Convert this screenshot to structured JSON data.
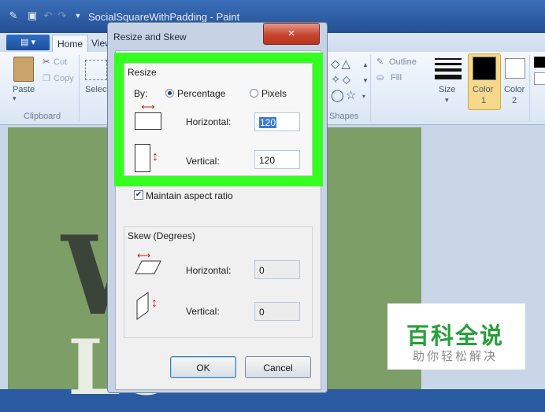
{
  "app": {
    "title": "SocialSquareWithPadding - Paint"
  },
  "ribbon": {
    "tabs": [
      "Home",
      "View"
    ],
    "paste_label": "Paste",
    "cut_label": "Cut",
    "copy_label": "Copy",
    "select_label": "Select",
    "clipboard_group": "Clipboard",
    "shapes_group": "Shapes",
    "outline_label": "Outline",
    "fill_label": "Fill",
    "size_label": "Size",
    "color1_label": "Color",
    "color1_num": "1",
    "color2_label": "Color",
    "color2_num": "2"
  },
  "dialog": {
    "title": "Resize and Skew",
    "close_glyph": "×",
    "resize": {
      "heading": "Resize",
      "by_label": "By:",
      "percentage_label": "Percentage",
      "pixels_label": "Pixels",
      "selected_mode": "Percentage",
      "horizontal_label": "Horizontal:",
      "horizontal_value": "120",
      "vertical_label": "Vertical:",
      "vertical_value": "120"
    },
    "maintain_aspect_label": "Maintain aspect ratio",
    "maintain_aspect_checked": true,
    "skew": {
      "heading": "Skew (Degrees)",
      "horizontal_label": "Horizontal:",
      "horizontal_value": "0",
      "vertical_label": "Vertical:",
      "vertical_value": "0"
    },
    "ok_label": "OK",
    "cancel_label": "Cancel"
  },
  "canvas": {
    "text_line1": "Wi",
    "text_line2": "Lo"
  },
  "watermark": {
    "title": "百科全说",
    "subtitle": "助你轻松解决"
  },
  "colors": {
    "highlight": "#35ff20",
    "accent_red": "#c0392b",
    "canvas_bg": "#7e9e68"
  }
}
